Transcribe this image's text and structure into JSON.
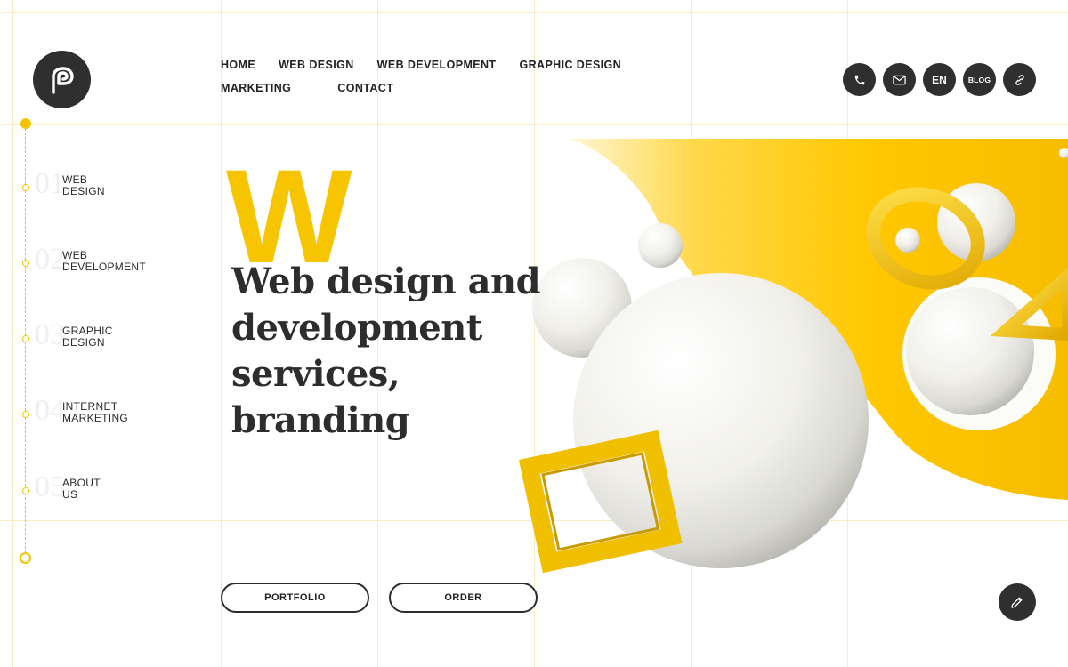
{
  "nav": {
    "items": [
      "HOME",
      "WEB DESIGN",
      "WEB DEVELOPMENT",
      "GRAPHIC DESIGN",
      "MARKETING",
      "CONTACT"
    ]
  },
  "top_icons": {
    "phone": "phone-icon",
    "mail": "mail-icon",
    "language": "EN",
    "blog": "BLOG",
    "link": "link-icon"
  },
  "sidebar": {
    "items": [
      {
        "number": "01",
        "line1": "WEB",
        "line2": "DESIGN"
      },
      {
        "number": "02",
        "line1": "WEB",
        "line2": "DEVELOPMENT"
      },
      {
        "number": "03",
        "line1": "GRAPHIC",
        "line2": "DESIGN"
      },
      {
        "number": "04",
        "line1": "INTERNET",
        "line2": "MARKETING"
      },
      {
        "number": "05",
        "line1": "ABOUT",
        "line2": "US"
      }
    ]
  },
  "hero": {
    "big_letter": "W",
    "headline_line1": "Web design and",
    "headline_line2": "development services,",
    "headline_line3": "branding"
  },
  "cta": {
    "portfolio": "PORTFOLIO",
    "order": "ORDER"
  },
  "colors": {
    "accent": "#f7c500",
    "dark": "#2f2f2f"
  }
}
